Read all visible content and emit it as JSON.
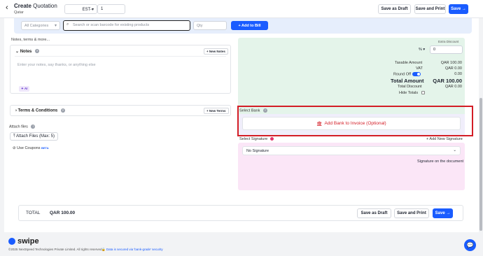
{
  "header": {
    "title": "Create",
    "title_suffix": "Quotation",
    "subtitle": "Qatar",
    "prefix": "EST-",
    "number": "1",
    "save_draft": "Save as Draft",
    "save_print": "Save and Print",
    "save": "Save →"
  },
  "search": {
    "category_placeholder": "All Categories",
    "product_placeholder": "Search or scan barcode for existing products",
    "qty_placeholder": "Qty",
    "add_to_bill": "+ Add to Bill"
  },
  "notes_section": {
    "heading": "Notes, terms & more...",
    "notes_title": "Notes",
    "new_notes": "+ New Notes",
    "notes_placeholder": "Enter your notes, say thanks, or anything else",
    "ai_badge": "AI",
    "terms_title": "Terms & Conditions",
    "new_terms": "+ New Terms",
    "attach_label": "Attach files",
    "attach_button": "Attach Files (Max: 5)",
    "coupons": "Use Coupons",
    "beta": "BETA"
  },
  "summary": {
    "extra_discount_label": "Extra Discount",
    "discount_type": "%",
    "discount_value": "0",
    "rows": [
      {
        "label": "Taxable Amount",
        "value": "QAR 100.00"
      },
      {
        "label": "VAT",
        "value": "QAR 0.00"
      },
      {
        "label": "Round Off",
        "value": "0.00"
      }
    ],
    "total_label": "Total Amount",
    "total_value": "QAR 100.00",
    "total_discount_label": "Total Discount",
    "total_discount_value": "QAR 0.00",
    "hide_totals": "Hide Totals"
  },
  "bank": {
    "label": "Select Bank",
    "button": "Add Bank to Invoice (Optional)"
  },
  "signature": {
    "label": "Select Signature",
    "add_new": "+ Add New Signature",
    "selected": "No Signature",
    "caption": "Signature on the document"
  },
  "totalbar": {
    "label": "TOTAL",
    "value": "QAR 100.00",
    "save_draft": "Save as Draft",
    "save_print": "Save and Print",
    "save": "Save →"
  },
  "footer": {
    "brand": "swipe",
    "copyright": "©2025 NextSpeed Technologies Private Limited. All rights reserved.",
    "security": "Data is secured via 'bank-grade' security"
  }
}
